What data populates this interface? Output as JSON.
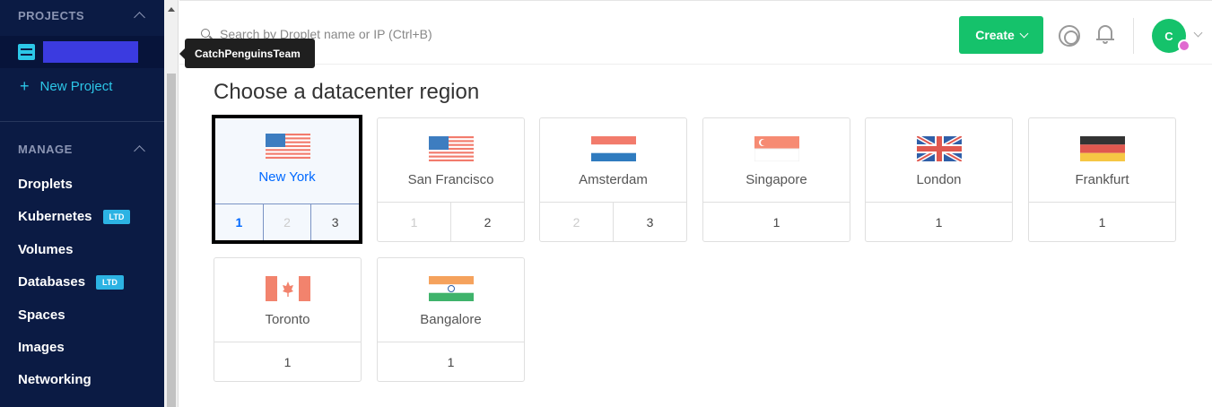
{
  "sidebar": {
    "projects_heading": "PROJECTS",
    "new_project_label": "New Project",
    "manage_heading": "MANAGE",
    "nav": [
      {
        "label": "Droplets",
        "badge": ""
      },
      {
        "label": "Kubernetes",
        "badge": "LTD"
      },
      {
        "label": "Volumes",
        "badge": ""
      },
      {
        "label": "Databases",
        "badge": "LTD"
      },
      {
        "label": "Spaces",
        "badge": ""
      },
      {
        "label": "Images",
        "badge": ""
      },
      {
        "label": "Networking",
        "badge": ""
      }
    ]
  },
  "tooltip": {
    "text": "CatchPenguinsTeam"
  },
  "topbar": {
    "search_placeholder": "Search by Droplet name or IP (Ctrl+B)",
    "create_label": "Create",
    "avatar_initial": "C"
  },
  "main": {
    "heading": "Choose a datacenter region",
    "regions": [
      {
        "name": "New York",
        "flag": "us-flag-icon",
        "numbers": [
          "1",
          "2",
          "3"
        ],
        "disabled": [
          false,
          true,
          false
        ],
        "active": "1",
        "selected": true
      },
      {
        "name": "San Francisco",
        "flag": "us-flag-icon",
        "numbers": [
          "1",
          "2"
        ],
        "disabled": [
          true,
          false
        ],
        "active": "",
        "selected": false
      },
      {
        "name": "Amsterdam",
        "flag": "nl-flag-icon",
        "numbers": [
          "2",
          "3"
        ],
        "disabled": [
          true,
          false
        ],
        "active": "",
        "selected": false
      },
      {
        "name": "Singapore",
        "flag": "sg-flag-icon",
        "numbers": [
          "1"
        ],
        "disabled": [
          false
        ],
        "active": "",
        "selected": false
      },
      {
        "name": "London",
        "flag": "uk-flag-icon",
        "numbers": [
          "1"
        ],
        "disabled": [
          false
        ],
        "active": "",
        "selected": false
      },
      {
        "name": "Frankfurt",
        "flag": "de-flag-icon",
        "numbers": [
          "1"
        ],
        "disabled": [
          false
        ],
        "active": "",
        "selected": false
      },
      {
        "name": "Toronto",
        "flag": "ca-flag-icon",
        "numbers": [
          "1"
        ],
        "disabled": [
          false
        ],
        "active": "",
        "selected": false
      },
      {
        "name": "Bangalore",
        "flag": "in-flag-icon",
        "numbers": [
          "1"
        ],
        "disabled": [
          false
        ],
        "active": "",
        "selected": false
      }
    ]
  },
  "colors": {
    "sidebar_bg": "#0b1b44",
    "accent_cyan": "#2cc7e8",
    "create_green": "#15c26b",
    "selected_blue": "#0069ff"
  }
}
